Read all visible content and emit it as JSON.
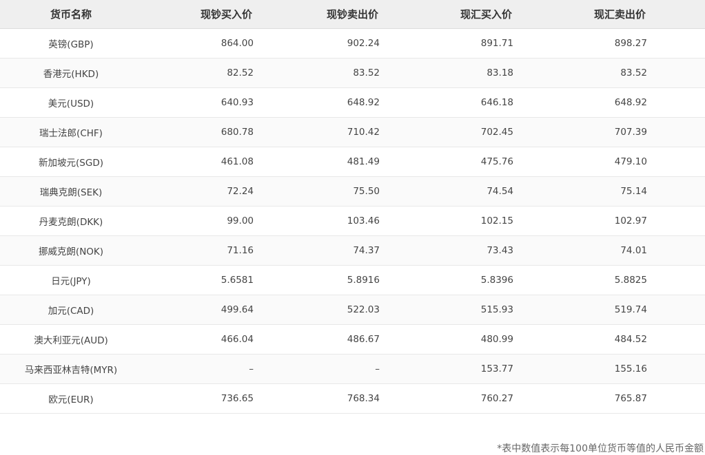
{
  "table": {
    "headers": [
      "货币名称",
      "现钞买入价",
      "现钞卖出价",
      "现汇买入价",
      "现汇卖出价"
    ],
    "rows": [
      [
        "英镑(GBP)",
        "864.00",
        "902.24",
        "891.71",
        "898.27"
      ],
      [
        "香港元(HKD)",
        "82.52",
        "83.52",
        "83.18",
        "83.52"
      ],
      [
        "美元(USD)",
        "640.93",
        "648.92",
        "646.18",
        "648.92"
      ],
      [
        "瑞士法郎(CHF)",
        "680.78",
        "710.42",
        "702.45",
        "707.39"
      ],
      [
        "新加坡元(SGD)",
        "461.08",
        "481.49",
        "475.76",
        "479.10"
      ],
      [
        "瑞典克朗(SEK)",
        "72.24",
        "75.50",
        "74.54",
        "75.14"
      ],
      [
        "丹麦克朗(DKK)",
        "99.00",
        "103.46",
        "102.15",
        "102.97"
      ],
      [
        "挪威克朗(NOK)",
        "71.16",
        "74.37",
        "73.43",
        "74.01"
      ],
      [
        "日元(JPY)",
        "5.6581",
        "5.8916",
        "5.8396",
        "5.8825"
      ],
      [
        "加元(CAD)",
        "499.64",
        "522.03",
        "515.93",
        "519.74"
      ],
      [
        "澳大利亚元(AUD)",
        "466.04",
        "486.67",
        "480.99",
        "484.52"
      ],
      [
        "马来西亚林吉特(MYR)",
        "–",
        "–",
        "153.77",
        "155.16"
      ],
      [
        "欧元(EUR)",
        "736.65",
        "768.34",
        "760.27",
        "765.87"
      ]
    ]
  },
  "footnote": "*表中数值表示每100单位货币等值的人民币金额"
}
